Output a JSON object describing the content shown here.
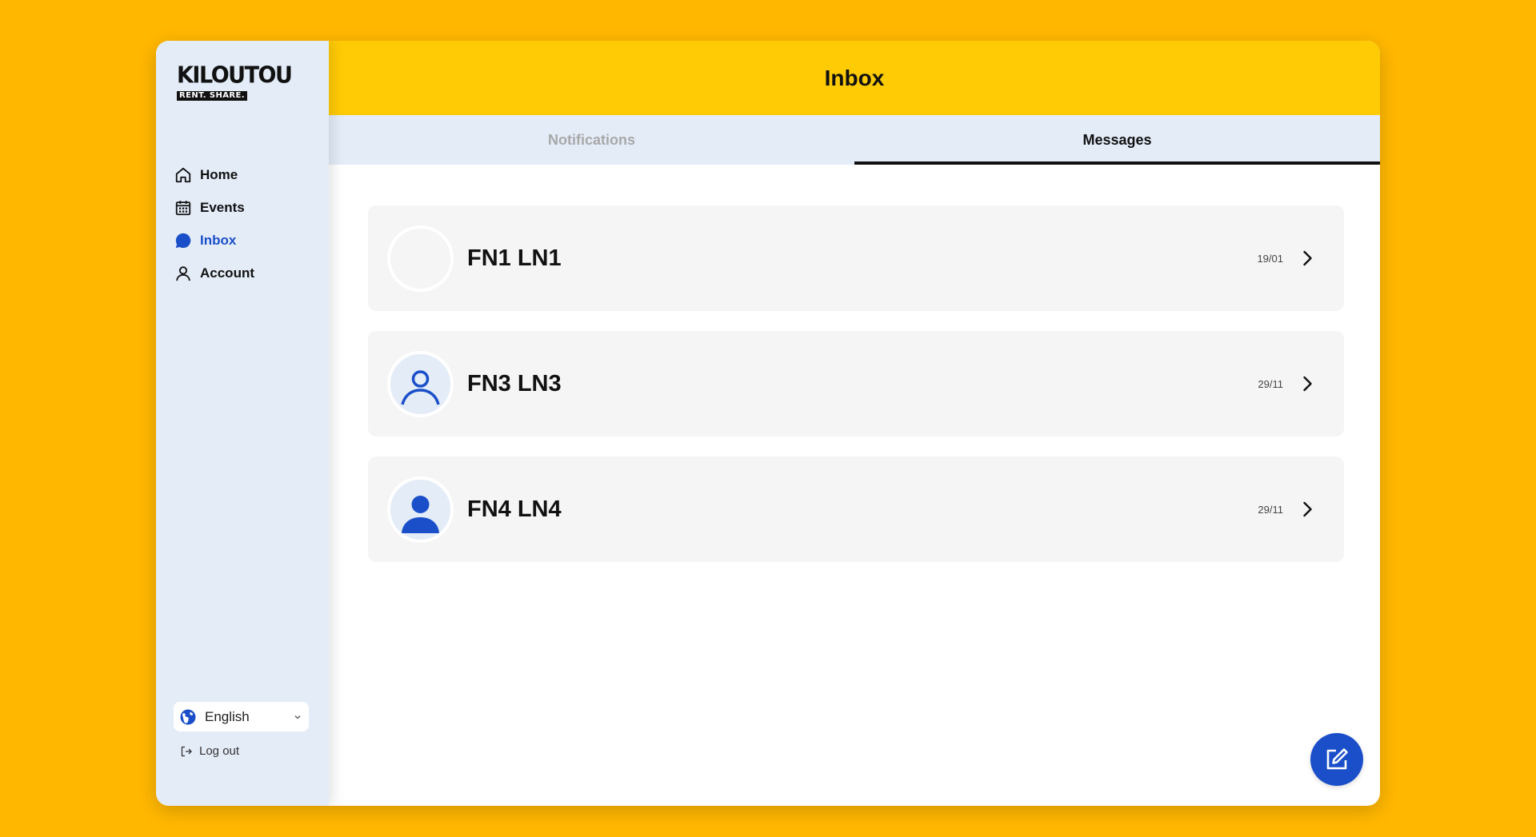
{
  "brand": {
    "name": "KILOUTOU",
    "tagline": "RENT. SHARE.",
    "accent": "#FFCB05",
    "background": "#FFB700",
    "primary": "#1A4FC9"
  },
  "sidebar": {
    "items": [
      {
        "label": "Home",
        "icon": "home-icon",
        "active": false
      },
      {
        "label": "Events",
        "icon": "calendar-icon",
        "active": false
      },
      {
        "label": "Inbox",
        "icon": "chat-bubble-icon",
        "active": true
      },
      {
        "label": "Account",
        "icon": "user-icon",
        "active": false
      }
    ],
    "language": {
      "selected": "English"
    },
    "logout_label": "Log out"
  },
  "header": {
    "title": "Inbox"
  },
  "tabs": [
    {
      "label": "Notifications",
      "active": false
    },
    {
      "label": "Messages",
      "active": true
    }
  ],
  "messages": [
    {
      "name": "FN1 LN1",
      "date": "19/01",
      "avatar": "blank"
    },
    {
      "name": "FN3 LN3",
      "date": "29/11",
      "avatar": "outline-user-icon"
    },
    {
      "name": "FN4 LN4",
      "date": "29/11",
      "avatar": "filled-user-icon"
    }
  ],
  "fab": {
    "icon": "compose-icon"
  }
}
